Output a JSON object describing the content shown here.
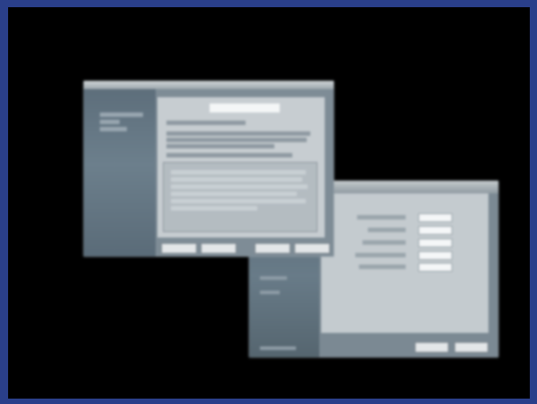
{
  "background_color": "#2a3f8a",
  "screen_color": "#000000",
  "wizard_window": {
    "sidebar": {
      "items": [
        "",
        "",
        ""
      ]
    },
    "buttons": [
      "",
      "",
      "",
      ""
    ]
  },
  "settings_dialog": {
    "fields": [
      {
        "label": "",
        "value": ""
      },
      {
        "label": "",
        "value": ""
      },
      {
        "label": "",
        "value": ""
      },
      {
        "label": "",
        "value": ""
      },
      {
        "label": "",
        "value": ""
      }
    ],
    "buttons": [
      "",
      ""
    ]
  }
}
